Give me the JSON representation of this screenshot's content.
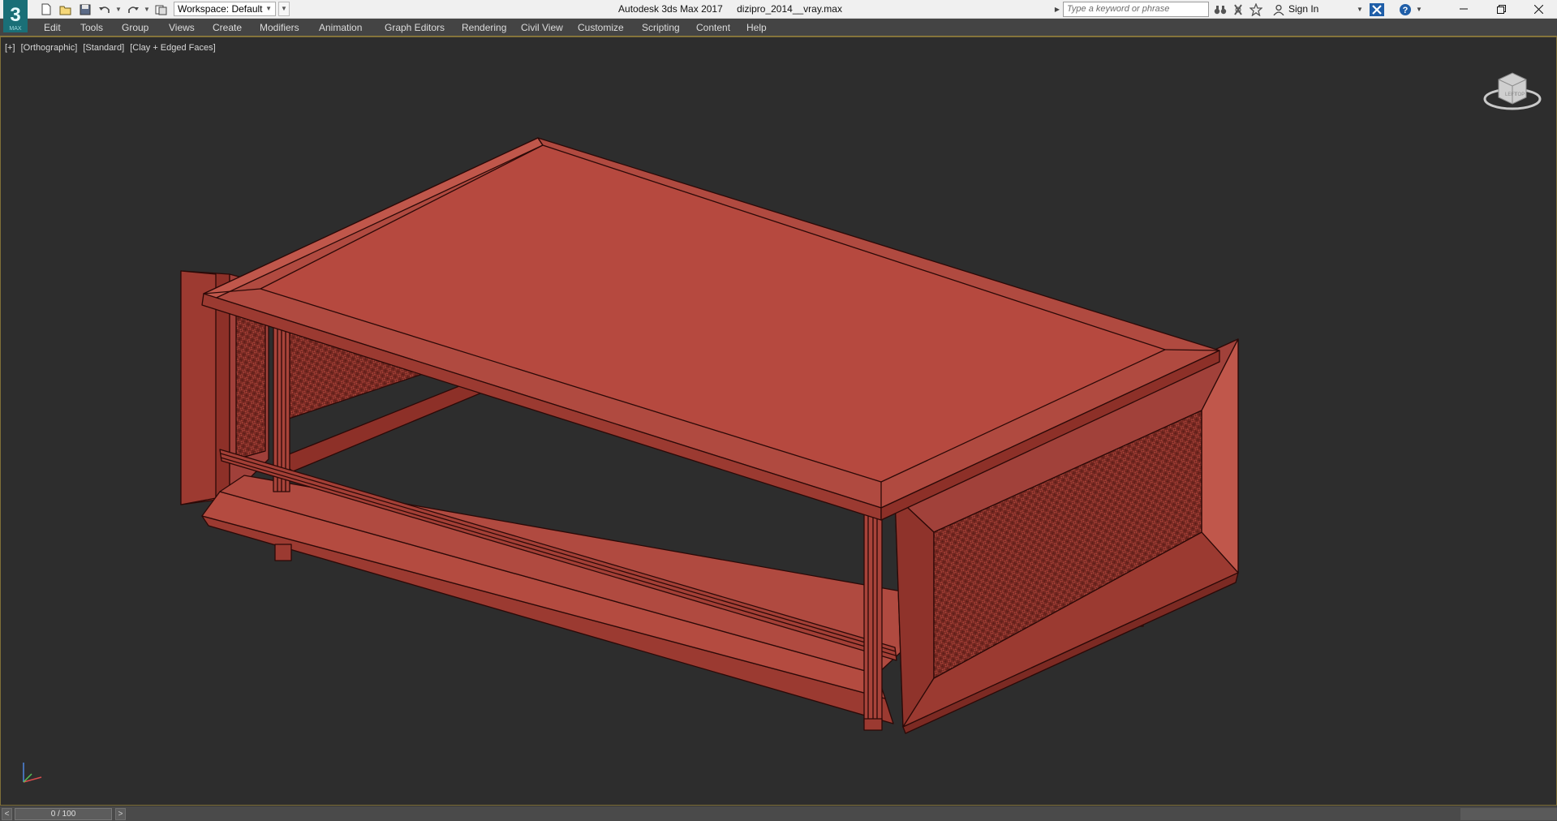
{
  "window": {
    "app_name": "Autodesk 3ds Max 2017",
    "file_name": "dizipro_2014__vray.max",
    "logo_text": "3",
    "logo_sub": "MAX"
  },
  "quick_access": {
    "workspace_label": "Workspace: Default"
  },
  "search": {
    "placeholder": "Type a keyword or phrase"
  },
  "account": {
    "sign_in_label": "Sign In"
  },
  "menu": {
    "items": [
      "Edit",
      "Tools",
      "Group",
      "Views",
      "Create",
      "Modifiers",
      "Animation",
      "Graph Editors",
      "Rendering",
      "Civil View",
      "Customize",
      "Scripting",
      "Content",
      "Help"
    ]
  },
  "viewport": {
    "labels": [
      "[+]",
      "[Orthographic]",
      "[Standard]",
      "[Clay + Edged Faces]"
    ],
    "viewcube_faces": [
      "TOP",
      "LEFT"
    ]
  },
  "timeline": {
    "frame_readout": "0 / 100",
    "prev_label": "<",
    "next_label": ">"
  },
  "colors": {
    "clay": "#b04a40",
    "clay_dark": "#8d3028",
    "clay_light": "#c0574b",
    "viewport_bg": "#2d2d2d",
    "menu_bg": "#444444",
    "active_border": "#7e6e38"
  }
}
